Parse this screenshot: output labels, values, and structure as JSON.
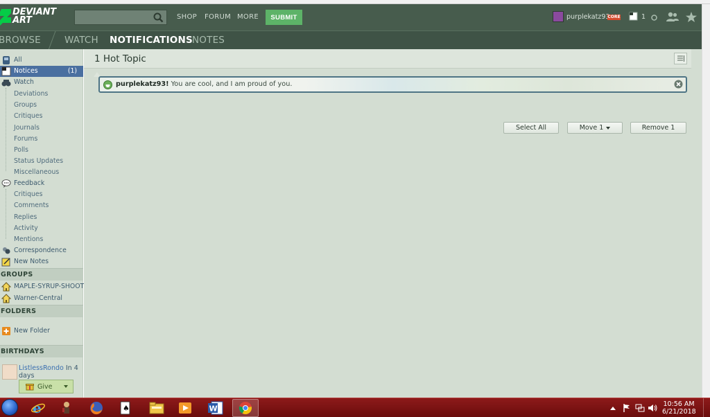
{
  "header": {
    "logo_line1": "DEVIANT",
    "logo_line2": "ART",
    "search_placeholder": "",
    "nav": [
      "SHOP",
      "FORUM",
      "MORE"
    ],
    "submit_label": "SUBMIT",
    "username": "purplekatz93",
    "core_badge": "CORE",
    "notes_count": "1"
  },
  "subnav": {
    "browse": "BROWSE",
    "watch": "WATCH",
    "notifications": "NOTIFICATIONS",
    "notes": "NOTES"
  },
  "sidebar": {
    "items": [
      {
        "label": "All"
      },
      {
        "label": "Notices",
        "count": "(1)"
      },
      {
        "label": "Watch"
      },
      {
        "label": "Deviations"
      },
      {
        "label": "Groups"
      },
      {
        "label": "Critiques"
      },
      {
        "label": "Journals"
      },
      {
        "label": "Forums"
      },
      {
        "label": "Polls"
      },
      {
        "label": "Status Updates"
      },
      {
        "label": "Miscellaneous"
      },
      {
        "label": "Feedback"
      },
      {
        "label": "Critiques"
      },
      {
        "label": "Comments"
      },
      {
        "label": "Replies"
      },
      {
        "label": "Activity"
      },
      {
        "label": "Mentions"
      },
      {
        "label": "Correspondence"
      },
      {
        "label": "New Notes"
      }
    ],
    "groups_heading": "GROUPS",
    "groups": [
      {
        "label": "MAPLE-SYRUP-SHOOTERS"
      },
      {
        "label": "Warner-Central"
      }
    ],
    "folders_heading": "FOLDERS",
    "new_folder": "New Folder",
    "birthdays_heading": "BIRTHDAYS",
    "birthday_user": "ListlessRondo",
    "birthday_when": " In 4 days",
    "give_label": "Give"
  },
  "main": {
    "title": "1 Hot Topic",
    "notice_user": "purplekatz93!",
    "notice_text": " You are cool, and I am proud of you.",
    "select_all": "Select All",
    "move": "Move 1",
    "remove": "Remove 1"
  },
  "taskbar": {
    "time": "10:56 AM",
    "date": "6/21/2018"
  },
  "colors": {
    "header_bg": "#475c4d",
    "subnav_bg": "#3f5346",
    "sidebar_bg": "#d3ddd2",
    "submit_green": "#5db368",
    "selected_blue": "#4a6fa0",
    "taskbar_red": "#7a1212"
  }
}
